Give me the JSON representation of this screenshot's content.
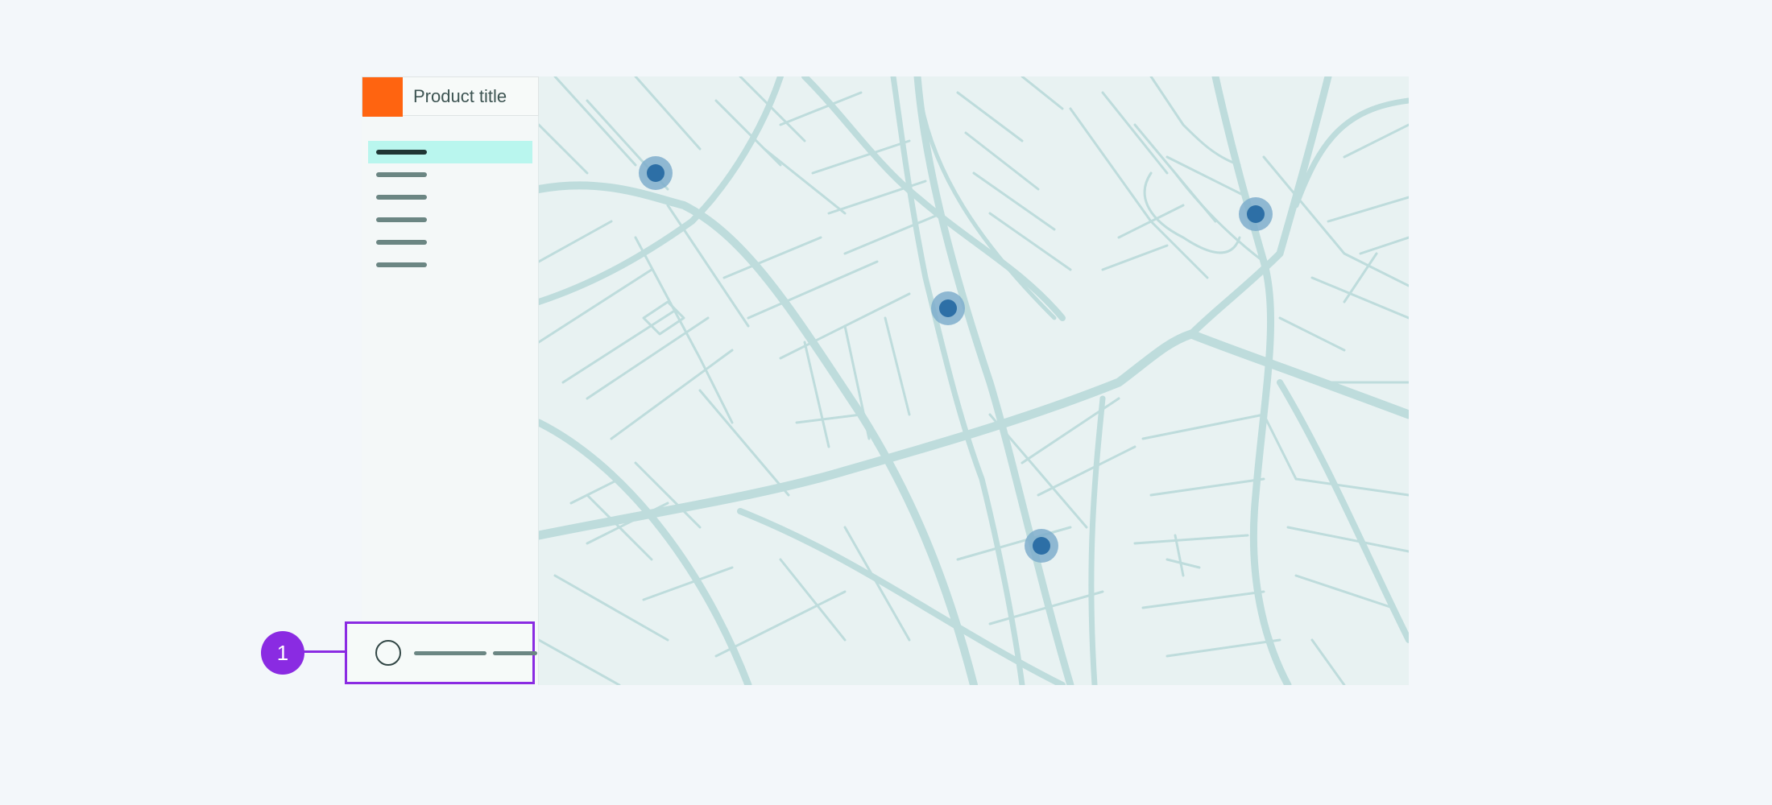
{
  "header": {
    "product_title": "Product title"
  },
  "sidebar": {
    "items": [
      {
        "state": "active"
      },
      {
        "state": "default"
      },
      {
        "state": "default"
      },
      {
        "state": "default"
      },
      {
        "state": "default"
      },
      {
        "state": "default"
      }
    ]
  },
  "callout": {
    "number": "1"
  },
  "colors": {
    "brand": "#ff6410",
    "nav_active": "#b9f6ee",
    "callout": "#8a2be2",
    "map_bg": "#e8f2f2",
    "road": "#bedcdc",
    "pin": "#2d6fa6",
    "pin_halo": "#7faecc"
  },
  "map": {
    "pins": [
      {
        "name": "map-pin-1"
      },
      {
        "name": "map-pin-2"
      },
      {
        "name": "map-pin-3"
      },
      {
        "name": "map-pin-4"
      }
    ]
  }
}
